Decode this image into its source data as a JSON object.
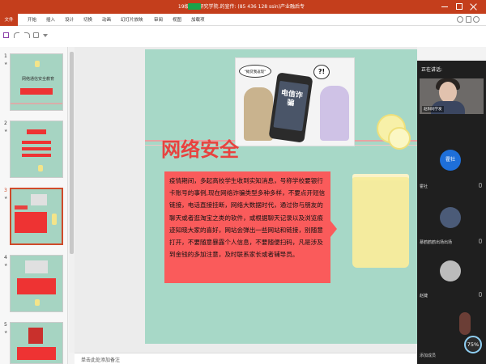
{
  "window": {
    "title": "19级农村研究学院.",
    "title_highlight": "",
    "title_rest": "的宣传: (85 436 128 ssin)产业融后专"
  },
  "ribbon": {
    "file_label": "文件",
    "tabs": [
      "开始",
      "插入",
      "设计",
      "切换",
      "动画",
      "幻灯片放映",
      "审阅",
      "视图",
      "加载项"
    ]
  },
  "thumbnails": [
    {
      "num": "1",
      "star": "★",
      "title": "网络通信安全教育",
      "selected": false
    },
    {
      "num": "2",
      "star": "★",
      "title": "",
      "selected": false
    },
    {
      "num": "3",
      "star": "★",
      "title": "",
      "selected": true
    },
    {
      "num": "4",
      "star": "★",
      "title": "",
      "selected": false
    },
    {
      "num": "5",
      "star": "★",
      "title": "",
      "selected": false
    }
  ],
  "slide": {
    "title": "网络安全",
    "cartoon_bubble": "\"摊贷我返现\"",
    "cartoon_question": "?!",
    "phone_text": "电信诈骗",
    "body": "疫情期间，多起高校学生收到实知消息，号称学校要银行卡账号的事例,现在网络诈骗类型多种多样，不要点开短信链接，电话直接挂断，网络大数据时代，通过你与朋友的聊天或者逛淘宝之类的软件，或根据聊天记录以及浏览痕迹知晓大家的喜好，网站会弹出一些网站和链接，别随意打开，不要随意暴露个人信息，不要随便扫码，凡是涉及到金钱的多加注意，及时联系家长或者辅导员。"
  },
  "notes": {
    "placeholder": "单击此处添加备注"
  },
  "video_panel": {
    "header": "正在讲话:",
    "main_speaker_tag": "赵阳同学发",
    "participants": [
      {
        "avatar_text": "霍社",
        "name": "霍社",
        "color": "#1e6fd9"
      },
      {
        "avatar_text": "",
        "name": "慕鹤鹤鹤出场出场",
        "color": "#4b5b78"
      },
      {
        "avatar_text": "",
        "name": "赵婕",
        "color": "#bcbcbc"
      }
    ],
    "bottom_label": "添加成员",
    "percent": "75%"
  }
}
